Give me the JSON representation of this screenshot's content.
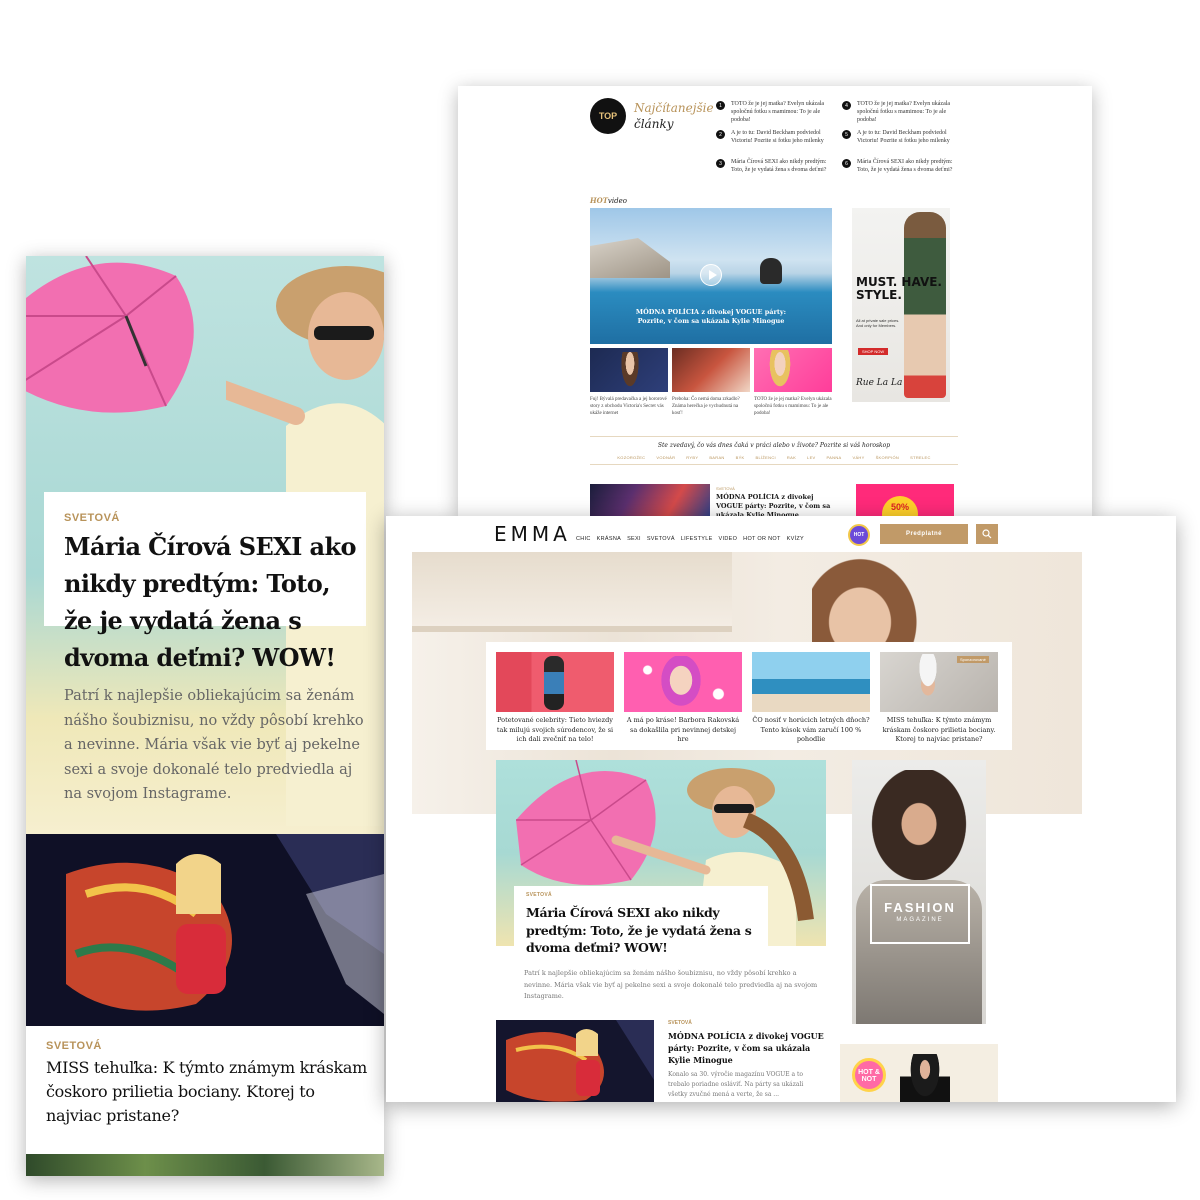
{
  "back_screen": {
    "top_section": {
      "badge": "TOP",
      "title_line1": "Najčítanejšie",
      "title_line2": "články",
      "items": [
        {
          "num": "1",
          "text": "TOTO že je jej matka? Evelyn ukázala spoločnú fotku s mamimou: To je ale podoba!"
        },
        {
          "num": "2",
          "text": "A je to tu: David Beckham podviedol Victoriu! Pozrite si fotku jeho milenky"
        },
        {
          "num": "3",
          "text": "Mária Čírová SEXI ako nikdy predtým: Toto, že je vydatá žena s dvoma deťmi?"
        },
        {
          "num": "4",
          "text": "TOTO že je jej matka? Evelyn ukázala spoločnú fotku s mamimou: To je ale podoba!"
        },
        {
          "num": "5",
          "text": "A je to tu: David Beckham podviedol Victoriu! Pozrite si fotku jeho milenky"
        },
        {
          "num": "6",
          "text": "Mária Čírová SEXI ako nikdy predtým: Toto, že je vydatá žena s dvoma deťmi?"
        }
      ]
    },
    "hot_video": {
      "prefix": "HOT",
      "suffix": "video"
    },
    "video_caption": "MÓDNA POLÍCIA z divokej VOGUE párty: Pozrite, v čom sa ukázala Kylie Minogue",
    "thumbs": [
      {
        "caption": "Fuj! Bývalá predavačka a jej hororové story z obchodu Victoria's Secret vás ukáže internet"
      },
      {
        "caption": "Preboha: Čo nemá doma zrkadlo? Známa herečka je vychudnutá na kosť!"
      },
      {
        "caption": "TOTO že je jej matka? Evelyn ukázala spoločnú fotku s mamimou: To je ale podoba!"
      }
    ],
    "ad": {
      "headline": "MUST. HAVE. STYLE.",
      "sub": "All at private sale prices. And only for Members.",
      "shop": "SHOP NOW",
      "brand": "Rue La La"
    },
    "horoscope": {
      "question": "Ste zvedavý, čo vás dnes čaká v práci alebo v živote? Pozrite si váš horoskop",
      "signs": [
        "KOZOROŽEC",
        "VODNÁR",
        "RYBY",
        "BARAN",
        "BÝK",
        "BLÍŽENCI",
        "RAK",
        "LEV",
        "PANNA",
        "VÁHY",
        "ŠKORPIÓN",
        "STRELEC"
      ]
    },
    "bottom_article": {
      "category": "SVETOVÁ",
      "title": "MÓDNA POLÍCIA z divokej VOGUE párty: Pozrite, v čom sa ukázala Kylie Minogue"
    },
    "bottom_ad": {
      "text": "50%"
    }
  },
  "mobile_screen": {
    "article1": {
      "category": "SVETOVÁ",
      "title": "Mária Čírová SEXI ako nikdy predtým: Toto, že je vydatá žena s dvoma deťmi? WOW!",
      "excerpt": "Patrí k najlepšie obliekajúcim sa ženám nášho šoubiznisu, no vždy pôsobí krehko a nevinne. Mária však vie byť aj pekelne sexi a svoje dokonalé telo predviedla aj na svojom Instagrame."
    },
    "article2": {
      "category": "SVETOVÁ",
      "title": "MISS tehuľka: K týmto známym kráskam čoskoro prilietia bociany. Ktorej to najviac pristane?"
    }
  },
  "front_screen": {
    "logo": "EMMA",
    "nav": [
      "CHIC",
      "KRÁSNA",
      "SEXI",
      "SVETOVÁ",
      "LIFESTYLE",
      "VIDEO",
      "HOT OR NOT",
      "KVÍZY"
    ],
    "hot_badge": "HOT",
    "subscribe_label": "Predplatné",
    "tiles": [
      {
        "caption": "Potetované celebrity: Tieto hviezdy tak milujú svojich súrodencov, že si ich dali zvečniť na telo!"
      },
      {
        "caption": "A má po kráse! Barbora Rakovská sa dokašlila pri nevinnej detskej hre"
      },
      {
        "caption": "ČO nosiť v horúcich letných dňoch? Tento kúsok vám zaručí 100 % pohodlie"
      },
      {
        "caption": "MISS tehuľka: K týmto známym kráskam čoskoro prilietia bociany. Ktorej to najviac pristane?"
      }
    ],
    "sponsored_label": "Sponzorované",
    "main_article": {
      "category": "SVETOVÁ",
      "title": "Mária Čírová SEXI ako nikdy predtým: Toto, že je vydatá žena s dvoma deťmi? WOW!",
      "excerpt": "Patrí k najlepšie obliekajúcim sa ženám nášho šoubiznisu, no vždy pôsobí krehko a nevinne. Mária však vie byť aj pekelne sexi a svoje dokonalé telo predviedla aj na svojom Instagrame."
    },
    "fashion_ad": {
      "line1": "FASHION",
      "line2": "MAGAZINE"
    },
    "second_article": {
      "category": "SVETOVÁ",
      "title": "MÓDNA POLÍCIA z divokej VOGUE párty: Pozrite, v čom sa ukázala Kylie Minogue",
      "excerpt": "Konalo sa 30. výročie magazínu VOGUE a to trebalo poriadne osláviť. Na párty sa ukázali všetky zvučné mená a verte, že sa ..."
    },
    "hot_ad": {
      "text": "HOT & NOT"
    }
  }
}
